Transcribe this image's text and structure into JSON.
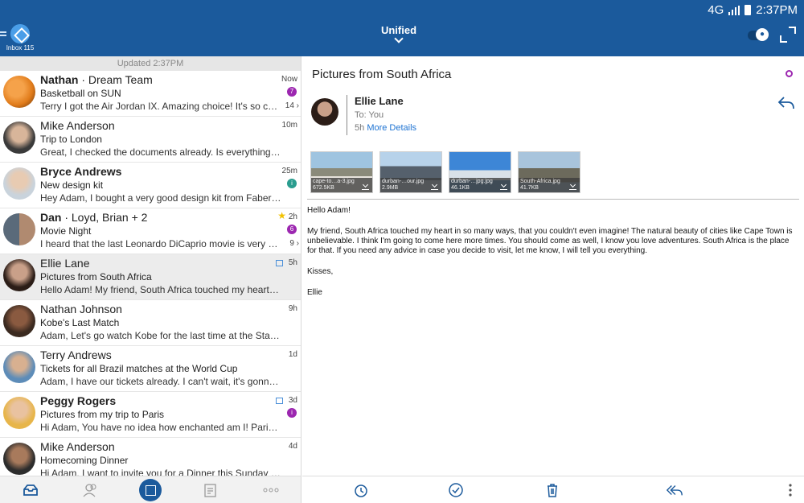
{
  "status": {
    "network": "4G",
    "time": "2:37PM"
  },
  "header": {
    "inbox_label": "Inbox",
    "inbox_count": "115",
    "title": "Unified"
  },
  "list": {
    "updated": "Updated 2:37PM",
    "items": [
      {
        "name": "Nathan",
        "name_extra": " · Dream Team",
        "subject": "Basketball on SUN",
        "preview": "Terry I got the Air Jordan IX. Amazing choice! It's so confortable",
        "time": "Now",
        "badge": "7",
        "badge_color": "#9c27b0",
        "count": "14",
        "bold": true
      },
      {
        "name": "Mike Anderson",
        "name_extra": "",
        "subject": "Trip to London",
        "preview": "Great, I checked the documents already. Is everything ok. I …",
        "time": "10m",
        "badge": "",
        "count": "",
        "bold": false
      },
      {
        "name": "Bryce Andrews",
        "name_extra": "",
        "subject": "New design kit",
        "preview": "Hey Adam, I bought a very good design kit from Faber Castel…",
        "time": "25m",
        "badge": "i",
        "badge_color": "#2a9d8f",
        "count": "",
        "bold": true
      },
      {
        "name": "Dan",
        "name_extra": " · Loyd, Brian + 2",
        "subject": "Movie Night",
        "preview": "I heard that the last Leonardo DiCaprio movie is very good…",
        "time": "2h",
        "badge": "6",
        "badge_color": "#9c27b0",
        "count": "9",
        "bold": true,
        "star": true
      },
      {
        "name": "Ellie Lane",
        "name_extra": "",
        "subject": "Pictures from South Africa",
        "preview": "Hello Adam! My friend, South Africa touched my heart in so many ways",
        "time": "5h",
        "badge": "",
        "count": "",
        "bold": false,
        "image": true,
        "selected": true
      },
      {
        "name": "Nathan Johnson",
        "name_extra": "",
        "subject": "Kobe's Last Match",
        "preview": "Adam, Let's go watch Kobe for the last time at the Staple's…",
        "time": "9h",
        "badge": "",
        "count": "",
        "bold": false
      },
      {
        "name": "Terry Andrews",
        "name_extra": "",
        "subject": "Tickets for all Brazil matches at the World Cup",
        "preview": "Adam, I have our tickets already. I can't wait, it's gonna be the…",
        "time": "1d",
        "badge": "",
        "count": "",
        "bold": false
      },
      {
        "name": "Peggy Rogers",
        "name_extra": "",
        "subject": "Pictures from my trip to Paris",
        "preview": "Hi Adam, You have no idea how enchanted am I! Paris!! Incredible",
        "time": "3d",
        "badge": "i",
        "badge_color": "#9c27b0",
        "count": "",
        "bold": true,
        "image": true
      },
      {
        "name": "Mike Anderson",
        "name_extra": "",
        "subject": "Homecoming Dinner",
        "preview": "Hi Adam, I want to invite you for a Dinner this Sunday to celebrate",
        "time": "4d",
        "badge": "",
        "count": "",
        "bold": false
      }
    ]
  },
  "message": {
    "title": "Pictures from South Africa",
    "sender": "Ellie Lane",
    "to_label": "To:",
    "to": "You",
    "when": "5h",
    "more_details": "More Details",
    "attachments": [
      {
        "name": "cape-to…a-3.jpg",
        "size": "672.5KB"
      },
      {
        "name": "durban-…our.jpg",
        "size": "2.9MB"
      },
      {
        "name": "durban-…jpg.jpg",
        "size": "46.1KB"
      },
      {
        "name": "South-Africa.jpg",
        "size": "41.7KB"
      }
    ],
    "body": [
      "Hello Adam!",
      "My friend, South Africa touched my heart in so many ways, that you couldn't even imagine! The natural beauty of cities like Cape Town is unbelievable. I think I'm going to come here more times. You should come as well, I know you love adventures. South Africa is the place for that. If you need any advice in case you decide to visit, let me know, I will tell you everything.",
      "Kisses,",
      "Ellie"
    ]
  },
  "colors": {
    "header": "#1b5a9c",
    "accent": "#1e73d2"
  }
}
